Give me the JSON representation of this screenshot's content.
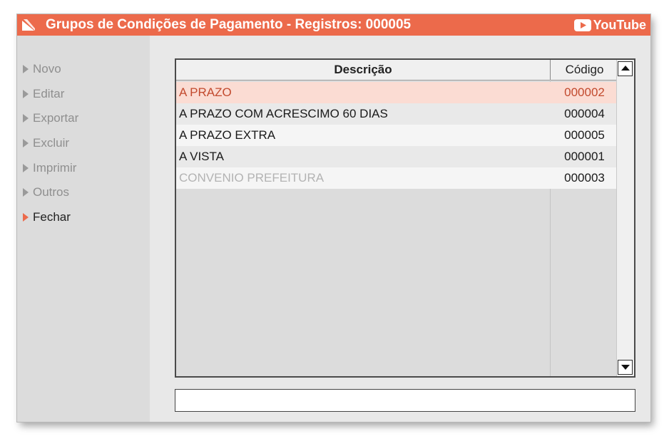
{
  "window": {
    "title": "Grupos de Condições de Pagamento - Registros: 000005",
    "youtube_label": "YouTube",
    "accent_color": "#ec6a4b"
  },
  "sidebar": {
    "items": [
      {
        "label": "Novo",
        "icon": "triangle-right-icon"
      },
      {
        "label": "Editar",
        "icon": "triangle-right-icon"
      },
      {
        "label": "Exportar",
        "icon": "triangle-right-icon"
      },
      {
        "label": "Excluir",
        "icon": "triangle-right-icon"
      },
      {
        "label": "Imprimir",
        "icon": "triangle-right-icon"
      },
      {
        "label": "Outros",
        "icon": "triangle-right-icon"
      },
      {
        "label": "Fechar",
        "icon": "triangle-right-icon"
      }
    ]
  },
  "table": {
    "columns": [
      "Descrição",
      "Código"
    ],
    "rows": [
      {
        "descricao": "A PRAZO",
        "codigo": "000002"
      },
      {
        "descricao": "A PRAZO COM ACRESCIMO 60 DIAS",
        "codigo": "000004"
      },
      {
        "descricao": "A PRAZO EXTRA",
        "codigo": "000005"
      },
      {
        "descricao": "A VISTA",
        "codigo": "000001"
      },
      {
        "descricao": "CONVENIO PREFEITURA",
        "codigo": "000003"
      }
    ]
  },
  "search": {
    "value": ""
  }
}
